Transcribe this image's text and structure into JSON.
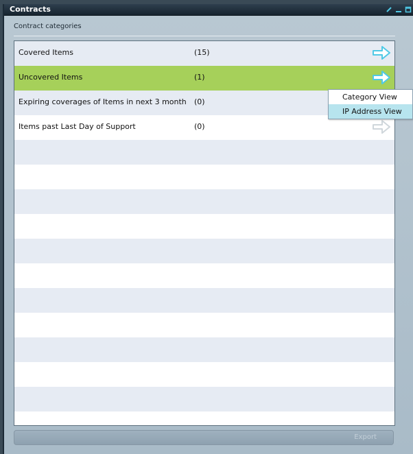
{
  "window": {
    "title": "Contracts",
    "subtitle": "Contract categories"
  },
  "categories": [
    {
      "label": "Covered Items",
      "count": "(15)",
      "arrow": "arrow-right-icon",
      "arrow_color": "#4fc9e6",
      "state": "normal"
    },
    {
      "label": "Uncovered Items",
      "count": "(1)",
      "arrow": "arrow-right-icon",
      "arrow_color": "#4fc9e6",
      "state": "selected"
    },
    {
      "label": "Expiring coverages of Items in next 3 month",
      "count": "(0)",
      "arrow": "arrow-right-icon",
      "arrow_color": "#4fc9e6",
      "state": "normal"
    },
    {
      "label": "Items past Last Day of Support",
      "count": "(0)",
      "arrow": "arrow-right-icon",
      "arrow_color": "#cfd6db",
      "state": "disabled"
    }
  ],
  "context_menu": {
    "items": [
      {
        "label": "Category View",
        "hovered": false
      },
      {
        "label": "IP Address View",
        "hovered": true
      }
    ]
  },
  "footer": {
    "export_label": "Export"
  },
  "colors": {
    "selected_row": "#a6d05a",
    "alt_row": "#e6ebf3",
    "titlebar": "#1d2b37",
    "menu_hover": "#b7e4ee"
  }
}
